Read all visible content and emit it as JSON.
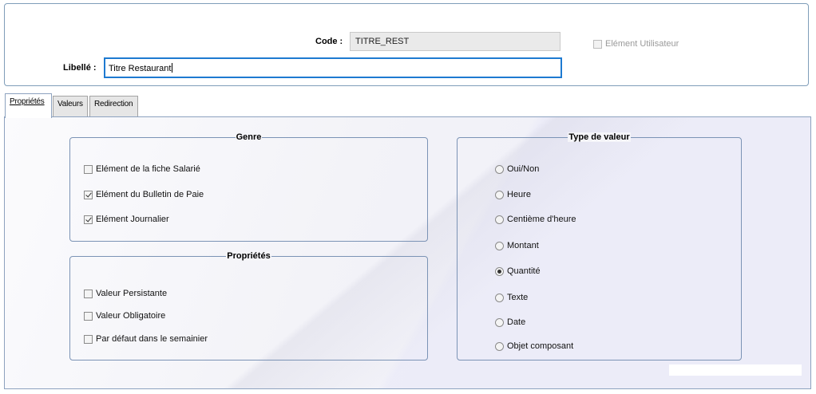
{
  "header": {
    "code_label": "Code :",
    "code_value": "TITRE_REST",
    "libelle_label": "Libellé :",
    "libelle_value": "Titre Restaurant",
    "user_element_label": "Elément Utilisateur",
    "user_element_checked": false
  },
  "tabs": [
    {
      "label": "Propriétés",
      "active": true
    },
    {
      "label": "Valeurs",
      "active": false
    },
    {
      "label": "Redirection",
      "active": false
    }
  ],
  "genre": {
    "title": "Genre",
    "items": [
      {
        "label": "Elément de la fiche Salarié",
        "checked": false
      },
      {
        "label": "Elément du Bulletin de Paie",
        "checked": true
      },
      {
        "label": "Elément Journalier",
        "checked": true
      }
    ]
  },
  "proprietes": {
    "title": "Propriétés",
    "items": [
      {
        "label": "Valeur Persistante",
        "checked": false
      },
      {
        "label": "Valeur Obligatoire",
        "checked": false
      },
      {
        "label": "Par défaut dans le semainier",
        "checked": false
      }
    ]
  },
  "type_valeur": {
    "title": "Type de valeur",
    "selected": "Quantité",
    "options": [
      {
        "label": "Oui/Non"
      },
      {
        "label": "Heure"
      },
      {
        "label": "Centième d'heure"
      },
      {
        "label": "Montant"
      },
      {
        "label": "Quantité"
      },
      {
        "label": "Texte"
      },
      {
        "label": "Date"
      },
      {
        "label": "Objet composant"
      }
    ]
  }
}
